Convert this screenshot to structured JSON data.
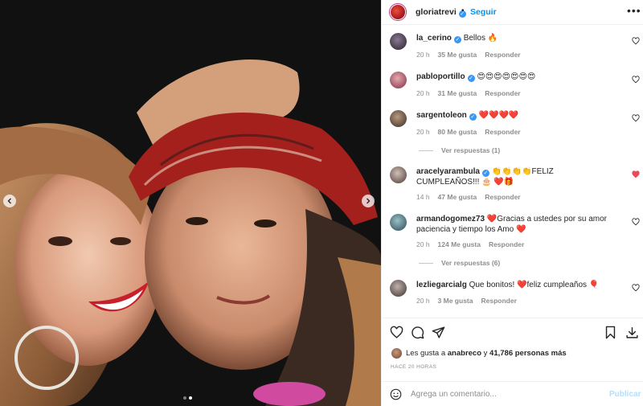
{
  "header": {
    "username": "gloriatrevi",
    "separator": "•",
    "follow_label": "Seguir",
    "more_label": "•••"
  },
  "comments": [
    {
      "user": "la_cerino",
      "verified": true,
      "text": "Bellos 🔥",
      "time": "20 h",
      "likes": "35 Me gusta",
      "reply": "Responder",
      "liked": false
    },
    {
      "user": "pabloportillo",
      "verified": true,
      "text": "😍😍😍😍😍😍😍",
      "time": "20 h",
      "likes": "31 Me gusta",
      "reply": "Responder",
      "liked": false
    },
    {
      "user": "sargentoleon",
      "verified": true,
      "text": "❤️❤️❤️❤️",
      "time": "20 h",
      "likes": "80 Me gusta",
      "reply": "Responder",
      "liked": false,
      "replies": "Ver respuestas (1)"
    },
    {
      "user": "aracelyarambula",
      "verified": true,
      "text": "👏👏👏👏FELIZ CUMPLEAÑOS!!! 🎂 ❤️🎁",
      "time": "14 h",
      "likes": "47 Me gusta",
      "reply": "Responder",
      "liked": true
    },
    {
      "user": "armandogomez73",
      "verified": false,
      "text": "❤️Gracias a ustedes por su amor paciencia y tiempo los Amo ❤️",
      "time": "20 h",
      "likes": "124 Me gusta",
      "reply": "Responder",
      "liked": false,
      "replies": "Ver respuestas (6)"
    },
    {
      "user": "lezliegarcialg",
      "verified": false,
      "text": "Que bonitos! ❤️feliz cumpleaños 🎈",
      "time": "20 h",
      "likes": "3 Me gusta",
      "reply": "Responder",
      "liked": false
    }
  ],
  "likes_line": {
    "prefix": "Les gusta a",
    "user": "anabreco",
    "middle": "y",
    "count": "41,786 personas más"
  },
  "timestamp": "HACE 20 HORAS",
  "add_comment": {
    "placeholder": "Agrega un comentario...",
    "publish_label": "Publicar"
  },
  "colors": {
    "accent": "#0095f6",
    "verified": "#3897f0",
    "liked_heart": "#ed4956",
    "muted": "#8e8e8e"
  }
}
